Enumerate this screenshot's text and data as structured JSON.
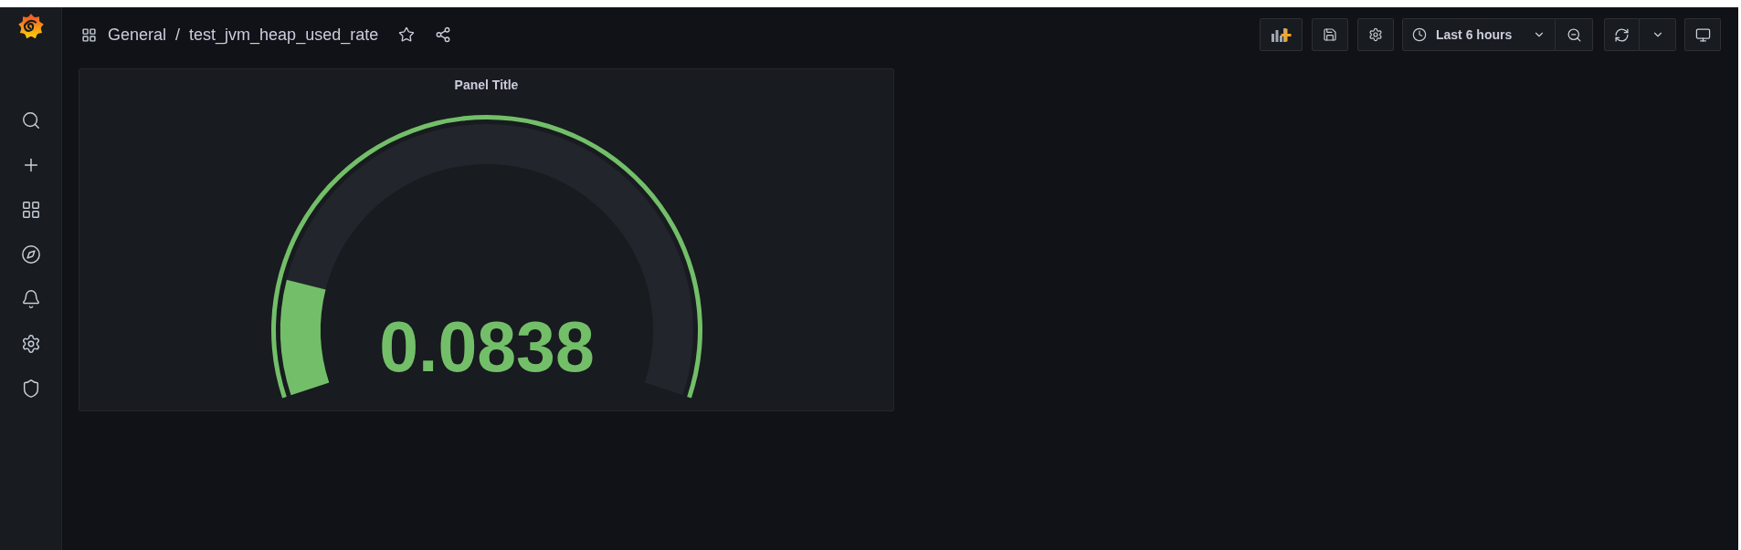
{
  "breadcrumb": {
    "folder": "General",
    "separator": "/",
    "dashboard": "test_jvm_heap_used_rate"
  },
  "toolbar": {
    "time_range": "Last 6 hours"
  },
  "panel": {
    "title": "Panel Title",
    "gauge": {
      "value": "0.0838",
      "level": 0.15
    }
  }
}
